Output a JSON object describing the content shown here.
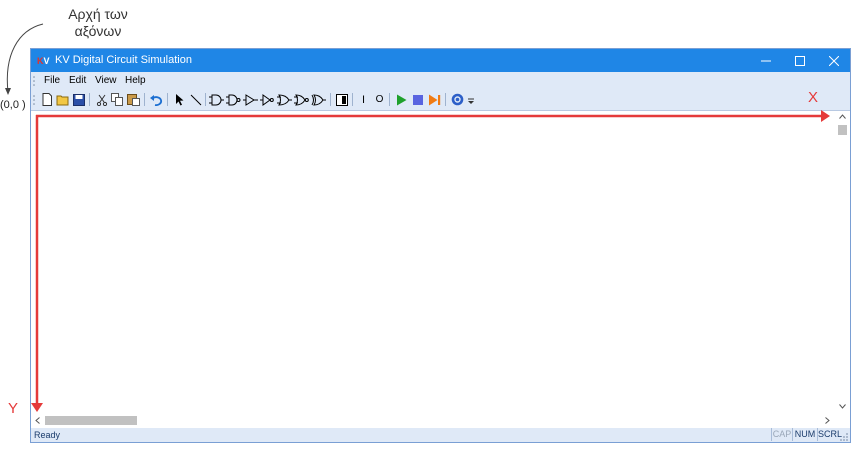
{
  "annotations": {
    "origin_title_line1": "Αρχή των",
    "origin_title_line2": "αξόνων",
    "origin_coords": "(0,0 )",
    "x_axis_label": "X",
    "y_axis_label": "Y",
    "axis_color": "#e53a3a"
  },
  "window": {
    "title": "KV Digital Circuit Simulation",
    "icon_k": "K",
    "icon_v": "V",
    "titlebar_color": "#1f86e6",
    "controls": [
      "minimize-icon",
      "maximize-icon",
      "close-icon"
    ]
  },
  "menu": {
    "items": [
      "File",
      "Edit",
      "View",
      "Help"
    ]
  },
  "toolbar": {
    "buttons": [
      "new-file-icon",
      "open-folder-icon",
      "save-icon",
      "cut-icon",
      "copy-icon",
      "paste-icon",
      "undo-icon",
      "select-arrow-icon",
      "wire-line-icon",
      "and-gate-icon",
      "nand-gate-icon",
      "buffer-gate-icon",
      "not-gate-icon",
      "or-gate-icon",
      "nor-gate-icon",
      "xor-gate-icon",
      "switch-icon",
      "input-icon",
      "output-icon",
      "run-icon",
      "stop-icon",
      "step-icon",
      "help-icon"
    ],
    "input_label": "I",
    "output_label": "O"
  },
  "statusbar": {
    "text": "Ready",
    "cap": "CAP",
    "num": "NUM",
    "scrl": "SCRL"
  }
}
